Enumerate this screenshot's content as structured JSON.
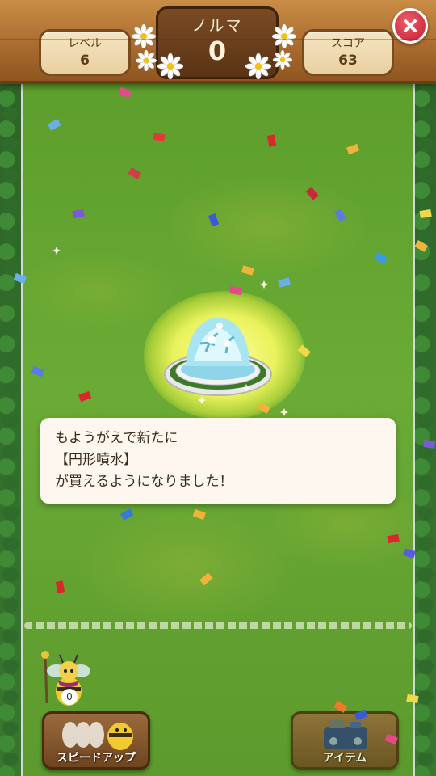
{
  "header": {
    "level_label": "レベル",
    "level_value": "6",
    "norma_label": "ノルマ",
    "norma_value": "0",
    "score_label": "スコア",
    "score_value": "63"
  },
  "message": {
    "line1": "もようがえで新たに",
    "line2": "【円形噴水】",
    "line3": "が買えるようになりました！"
  },
  "character": {
    "count": "0"
  },
  "buttons": {
    "speed_up": "スピードアップ",
    "item": "アイテム"
  },
  "colors": {
    "grass": "#5b9a2c",
    "wood": "#a86a2e",
    "close": "#c2202f",
    "glow": "#e9f25c"
  },
  "icons": [
    "close-icon",
    "daisy-icon",
    "fountain-icon",
    "bee-icon",
    "toolbox-icon"
  ]
}
